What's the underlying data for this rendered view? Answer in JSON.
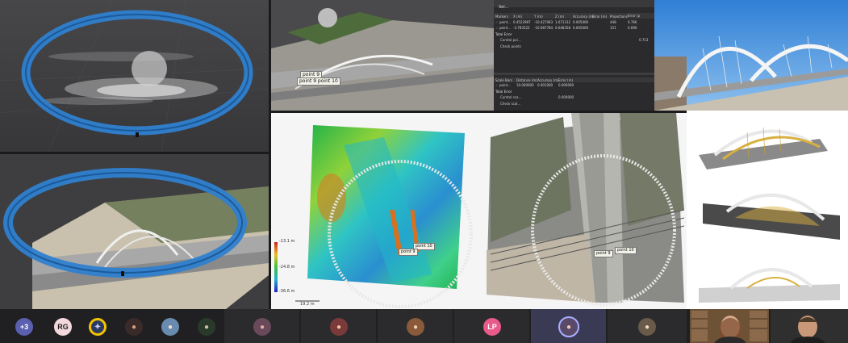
{
  "meeting": {
    "overflow_badge": "+3",
    "participants": [
      {
        "initials": "RG"
      },
      {
        "initials": "LP"
      }
    ]
  },
  "survey_table": {
    "header_title": "Sel...",
    "columns": [
      "Markers",
      "X (m)",
      "Y (m)",
      "Z (m)",
      "Accuracy (m)",
      "Error (m)",
      "Projections",
      "Error (pix)"
    ],
    "rows": [
      {
        "name": "point...",
        "x": "0.4522987",
        "y": "-10.427063",
        "z": "1.671312",
        "accuracy": "0.005000",
        "error": "",
        "projections": "448",
        "error_pix": "0.766"
      },
      {
        "name": "point...",
        "x": "-3.783522",
        "y": "-10.987784",
        "z": "0.648358",
        "accuracy": "0.005000",
        "error": "",
        "projections": "151",
        "error_pix": "0.690"
      }
    ],
    "total_error": "Total Error",
    "control_points": "Control poi...",
    "control_value": "0.713",
    "check_points": "Check points"
  },
  "scale_table": {
    "columns": [
      "Scale Bars",
      "Distance (m)",
      "Accuracy (m)",
      "Error (m)"
    ],
    "row": {
      "name": "point...",
      "distance": "10.000000",
      "accuracy": "0.001000",
      "error": "0.000000"
    },
    "total_error": "Total Error",
    "control_scale": "Control sca...",
    "control_value": "0.000000",
    "check_scale": "Check scal..."
  },
  "markers": {
    "point9": "point 9",
    "point10": "point 10",
    "point9_short": "point 9",
    "point10_short": "point 10",
    "point_combo": "point 9 point 10"
  },
  "elevation_legend": {
    "max": "-13.1 m",
    "mid": "-24.8 m",
    "min": "-36.6 m",
    "scale": "19.2 m"
  },
  "colors": {
    "ring": "#2f7fcf",
    "ring_dark": "#1b5a9a",
    "tray": "#202022",
    "highlight": "#f2c400",
    "active_tile": "#3a3a55"
  }
}
